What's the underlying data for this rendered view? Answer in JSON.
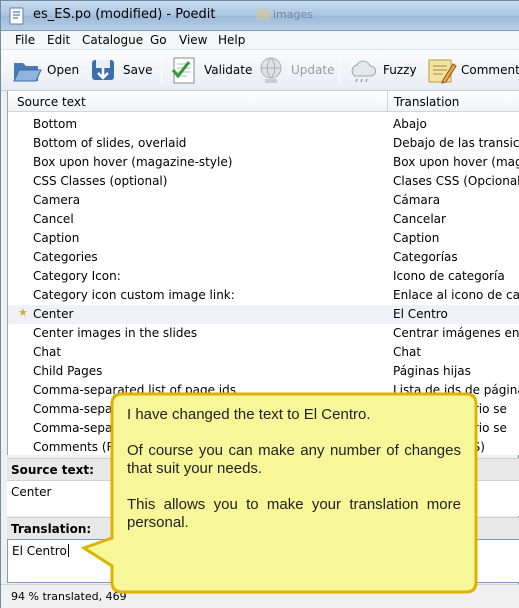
{
  "window": {
    "title": "es_ES.po (modified) - Poedit",
    "background_text": "images"
  },
  "menu": [
    {
      "label": "File"
    },
    {
      "label": "Edit"
    },
    {
      "label": "Catalogue"
    },
    {
      "label": "Go"
    },
    {
      "label": "View"
    },
    {
      "label": "Help"
    }
  ],
  "toolbar": {
    "open": "Open",
    "save": "Save",
    "validate": "Validate",
    "update": "Update",
    "fuzzy": "Fuzzy",
    "comment": "Comment"
  },
  "list": {
    "headers": {
      "source": "Source text",
      "translation": "Translation"
    },
    "rows": [
      {
        "source": "Bottom",
        "translation": "Abajo"
      },
      {
        "source": "Bottom of slides, overlaid",
        "translation": "Debajo de las transiciones"
      },
      {
        "source": "Box upon hover (magazine-style)",
        "translation": "Box upon hover (magazine"
      },
      {
        "source": "CSS Classes (optional)",
        "translation": "Clases CSS (Opcional"
      },
      {
        "source": "Camera",
        "translation": "Cámara"
      },
      {
        "source": "Cancel",
        "translation": "Cancelar"
      },
      {
        "source": "Caption",
        "translation": "Caption"
      },
      {
        "source": "Categories",
        "translation": "Categorías"
      },
      {
        "source": "Category Icon:",
        "translation": "Icono de categoría"
      },
      {
        "source": "Category icon custom image link:",
        "translation": "Enlace al icono de categ"
      },
      {
        "source": "Center",
        "translation": "El Centro"
      },
      {
        "source": "Center images in the slides",
        "translation": "Centrar imágenes en las"
      },
      {
        "source": "Chat",
        "translation": "Chat"
      },
      {
        "source": "Child Pages",
        "translation": "Páginas hijas"
      },
      {
        "source": "Comma-separated list of page ids.",
        "translation": "Lista de ids de página se"
      },
      {
        "source": "Comma-separat",
        "translation": "usuario se"
      },
      {
        "source": "Comma-separat",
        "translation": "usuario se"
      },
      {
        "source": "Comments (RS",
        "translation": "SS)"
      }
    ]
  },
  "source_pane": {
    "label": "Source text:",
    "value": "Center"
  },
  "translation_pane": {
    "label": "Translation:",
    "value": "El Centro"
  },
  "status": {
    "text": "94 % translated, 469"
  },
  "callout": {
    "paragraphs": [
      "I have changed the text to El Centro.",
      "Of course you can make any number of changes that suit your needs.",
      "This allows you to make your translation more personal."
    ],
    "fill": "#f7f79a",
    "border": "#e0b200"
  }
}
